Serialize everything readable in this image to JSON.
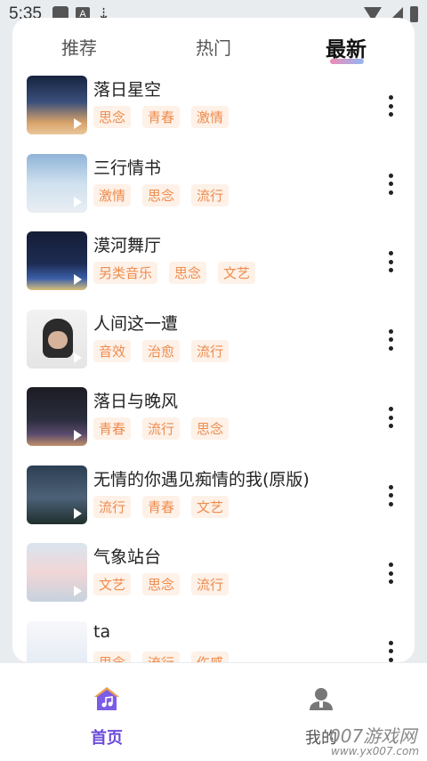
{
  "status": {
    "time": "5:35",
    "notif_letter": "A"
  },
  "tabs": [
    {
      "label": "推荐",
      "active": false
    },
    {
      "label": "热门",
      "active": false
    },
    {
      "label": "最新",
      "active": true
    }
  ],
  "songs": [
    {
      "title": "落日星空",
      "tags": [
        "思念",
        "青春",
        "激情"
      ]
    },
    {
      "title": "三行情书",
      "tags": [
        "激情",
        "思念",
        "流行"
      ]
    },
    {
      "title": "漠河舞厅",
      "tags": [
        "另类音乐",
        "思念",
        "文艺"
      ]
    },
    {
      "title": "人间这一遭",
      "tags": [
        "音效",
        "治愈",
        "流行"
      ]
    },
    {
      "title": "落日与晚风",
      "tags": [
        "青春",
        "流行",
        "思念"
      ]
    },
    {
      "title": "无情的你遇见痴情的我(原版)",
      "tags": [
        "流行",
        "青春",
        "文艺"
      ]
    },
    {
      "title": "气象站台",
      "tags": [
        "文艺",
        "思念",
        "流行"
      ]
    },
    {
      "title": "ta",
      "tags": [
        "思念",
        "流行",
        "伤感"
      ]
    }
  ],
  "bottom_nav": {
    "home_label": "首页",
    "me_label": "我的",
    "active_color": "#6c4bd8"
  },
  "watermark": {
    "text": "007游戏网",
    "url_text": "www.yx007.com"
  },
  "colors": {
    "tag_text": "#ef8b4c",
    "tag_bg": "#fdf1e8",
    "tab_underline": [
      "#f08bb3",
      "#8fb7f5"
    ]
  }
}
